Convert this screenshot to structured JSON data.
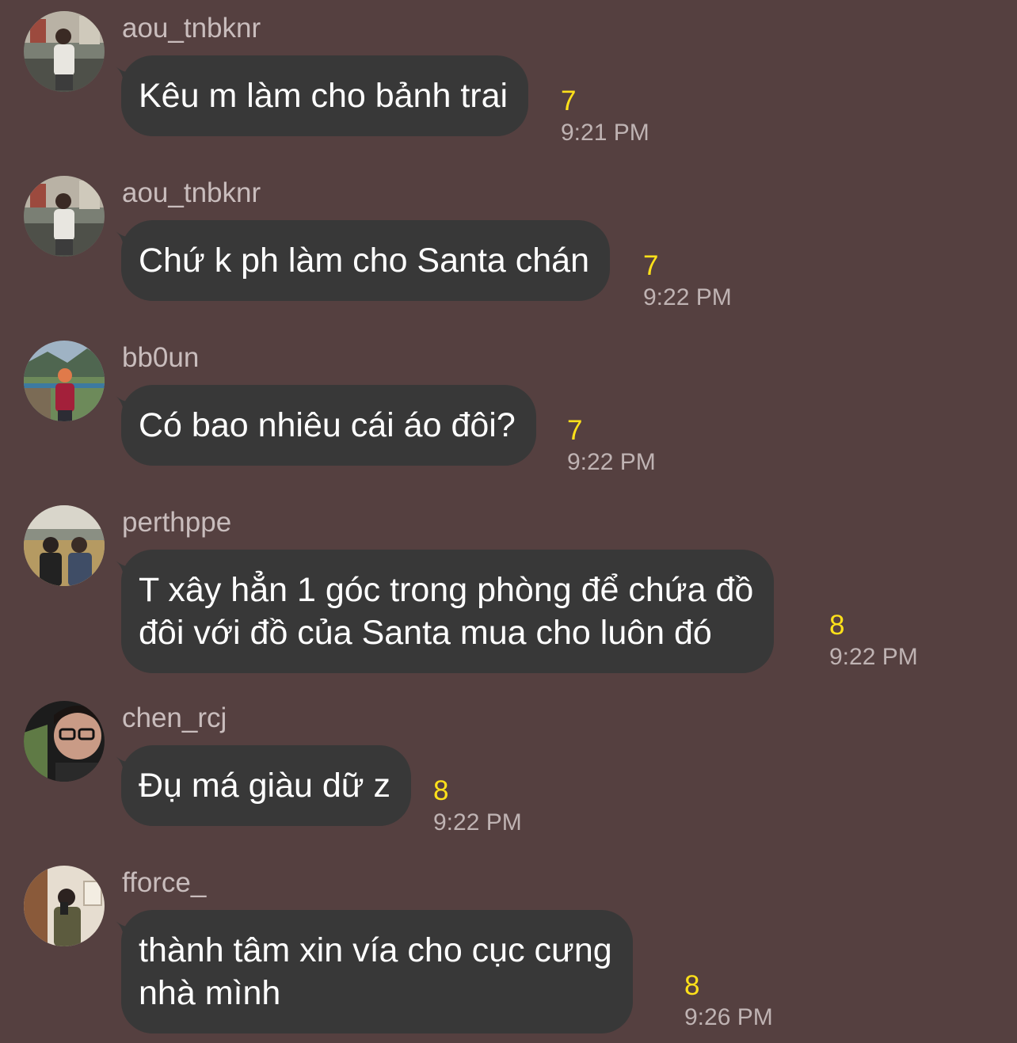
{
  "colors": {
    "background": "#554040",
    "bubble": "#383838",
    "username": "#c9bdbd",
    "message_text": "#ffffff",
    "count": "#ffe11a",
    "time": "#bfb3b3"
  },
  "messages": [
    {
      "username": "aou_tnbknr",
      "text_lines": [
        "Kêu m làm cho bảnh trai"
      ],
      "count": "7",
      "time": "9:21 PM",
      "avatar": "avatar-photo"
    },
    {
      "username": "aou_tnbknr",
      "text_lines": [
        "Chứ k ph làm cho Santa chán"
      ],
      "count": "7",
      "time": "9:22 PM",
      "avatar": "avatar-photo"
    },
    {
      "username": "bb0un",
      "text_lines": [
        "Có bao nhiêu cái áo đôi?"
      ],
      "count": "7",
      "time": "9:22 PM",
      "avatar": "avatar-photo"
    },
    {
      "username": "perthppe",
      "text_lines": [
        "T xây hẳn 1 góc trong phòng để chứa đồ",
        "đôi với đồ của Santa mua cho luôn đó"
      ],
      "count": "8",
      "time": "9:22 PM",
      "avatar": "avatar-photo"
    },
    {
      "username": "chen_rcj",
      "text_lines": [
        "Đụ má giàu dữ z"
      ],
      "count": "8",
      "time": "9:22 PM",
      "avatar": "avatar-photo"
    },
    {
      "username": "fforce_",
      "text_lines": [
        "thành tâm xin vía cho cục cưng",
        "nhà mình"
      ],
      "count": "8",
      "time": "9:26 PM",
      "avatar": "avatar-photo"
    }
  ]
}
